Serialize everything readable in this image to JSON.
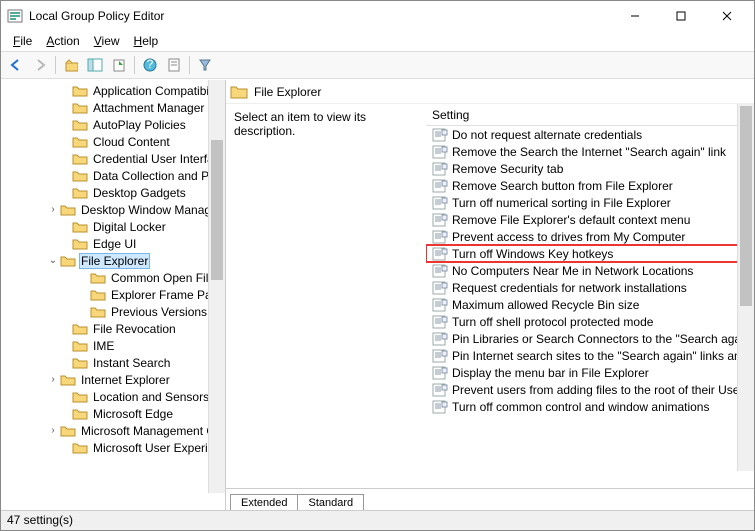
{
  "window": {
    "title": "Local Group Policy Editor"
  },
  "menu": {
    "file": "File",
    "action": "Action",
    "view": "View",
    "help": "Help"
  },
  "header": {
    "title": "File Explorer"
  },
  "description": "Select an item to view its description.",
  "columnHeader": "Setting",
  "tree": [
    {
      "indent": 54,
      "exp": "",
      "label": "Application Compatibility"
    },
    {
      "indent": 54,
      "exp": "",
      "label": "Attachment Manager"
    },
    {
      "indent": 54,
      "exp": "",
      "label": "AutoPlay Policies"
    },
    {
      "indent": 54,
      "exp": "",
      "label": "Cloud Content"
    },
    {
      "indent": 54,
      "exp": "",
      "label": "Credential User Interface"
    },
    {
      "indent": 54,
      "exp": "",
      "label": "Data Collection and Preview Builds"
    },
    {
      "indent": 54,
      "exp": "",
      "label": "Desktop Gadgets"
    },
    {
      "indent": 42,
      "exp": ">",
      "label": "Desktop Window Manager"
    },
    {
      "indent": 54,
      "exp": "",
      "label": "Digital Locker"
    },
    {
      "indent": 54,
      "exp": "",
      "label": "Edge UI"
    },
    {
      "indent": 42,
      "exp": "v",
      "label": "File Explorer",
      "selected": true
    },
    {
      "indent": 72,
      "exp": "",
      "label": "Common Open File Dialog"
    },
    {
      "indent": 72,
      "exp": "",
      "label": "Explorer Frame Pane"
    },
    {
      "indent": 72,
      "exp": "",
      "label": "Previous Versions"
    },
    {
      "indent": 54,
      "exp": "",
      "label": "File Revocation"
    },
    {
      "indent": 54,
      "exp": "",
      "label": "IME"
    },
    {
      "indent": 54,
      "exp": "",
      "label": "Instant Search"
    },
    {
      "indent": 42,
      "exp": ">",
      "label": "Internet Explorer"
    },
    {
      "indent": 54,
      "exp": "",
      "label": "Location and Sensors"
    },
    {
      "indent": 54,
      "exp": "",
      "label": "Microsoft Edge"
    },
    {
      "indent": 42,
      "exp": ">",
      "label": "Microsoft Management Console"
    },
    {
      "indent": 54,
      "exp": "",
      "label": "Microsoft User Experience Virtualization"
    }
  ],
  "settings": [
    {
      "label": "Do not request alternate credentials"
    },
    {
      "label": "Remove the Search the Internet \"Search again\" link"
    },
    {
      "label": "Remove Security tab"
    },
    {
      "label": "Remove Search button from File Explorer"
    },
    {
      "label": "Turn off numerical sorting in File Explorer"
    },
    {
      "label": "Remove File Explorer's default context menu"
    },
    {
      "label": "Prevent access to drives from My Computer"
    },
    {
      "label": "Turn off Windows Key hotkeys",
      "highlight": true
    },
    {
      "label": "No Computers Near Me in Network Locations"
    },
    {
      "label": "Request credentials for network installations"
    },
    {
      "label": "Maximum allowed Recycle Bin size"
    },
    {
      "label": "Turn off shell protocol protected mode"
    },
    {
      "label": "Pin Libraries or Search Connectors to the \"Search again\" links"
    },
    {
      "label": "Pin Internet search sites to the \"Search again\" links and the Start menu"
    },
    {
      "label": "Display the menu bar in File Explorer"
    },
    {
      "label": "Prevent users from adding files to the root of their Users Files folder"
    },
    {
      "label": "Turn off common control and window animations"
    }
  ],
  "tabs": {
    "extended": "Extended",
    "standard": "Standard"
  },
  "status": "47 setting(s)"
}
